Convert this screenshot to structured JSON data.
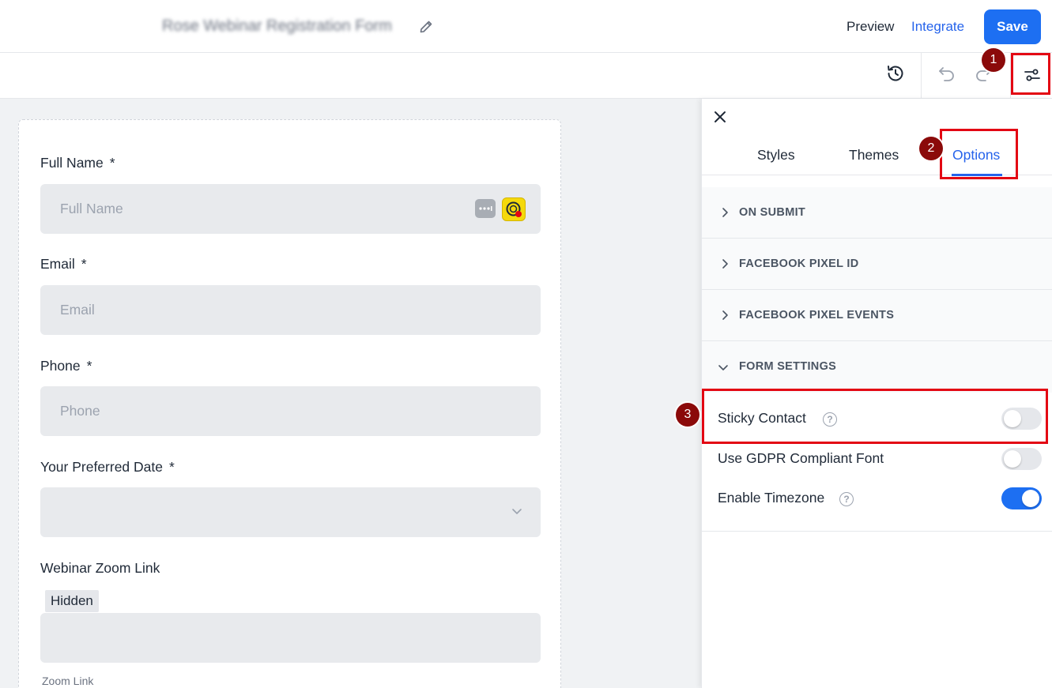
{
  "header": {
    "form_title": "Rose Webinar Registration Form",
    "preview_label": "Preview",
    "integrate_label": "Integrate",
    "save_label": "Save"
  },
  "toolbar": {
    "icons": [
      "history-icon",
      "undo-icon",
      "redo-icon",
      "settings-sliders-icon"
    ]
  },
  "annotations": {
    "badge_1": "1",
    "badge_2": "2",
    "badge_3": "3"
  },
  "form": {
    "fields": [
      {
        "label": "Full Name",
        "required": "*",
        "placeholder": "Full Name"
      },
      {
        "label": "Email",
        "required": "*",
        "placeholder": "Email"
      },
      {
        "label": "Phone",
        "required": "*",
        "placeholder": "Phone"
      },
      {
        "label": "Your Preferred Date",
        "required": "*",
        "placeholder": ""
      },
      {
        "label": "Webinar Zoom Link",
        "tag": "Hidden",
        "sublabel": "Zoom Link"
      }
    ]
  },
  "panel": {
    "tabs": [
      "Styles",
      "Themes",
      "Options"
    ],
    "active_tab": "Options",
    "sections": [
      "ON SUBMIT",
      "FACEBOOK PIXEL ID",
      "FACEBOOK PIXEL EVENTS",
      "FORM SETTINGS"
    ],
    "settings": [
      {
        "label": "Sticky Contact",
        "has_help": true,
        "enabled": false
      },
      {
        "label": "Use GDPR Compliant Font",
        "has_help": false,
        "enabled": false
      },
      {
        "label": "Enable Timezone",
        "has_help": true,
        "enabled": true
      }
    ],
    "help_glyph": "?"
  },
  "colors": {
    "accent": "#1d6ff2",
    "annotation_red": "#e30613",
    "badge_dark_red": "#8b0a0a"
  }
}
